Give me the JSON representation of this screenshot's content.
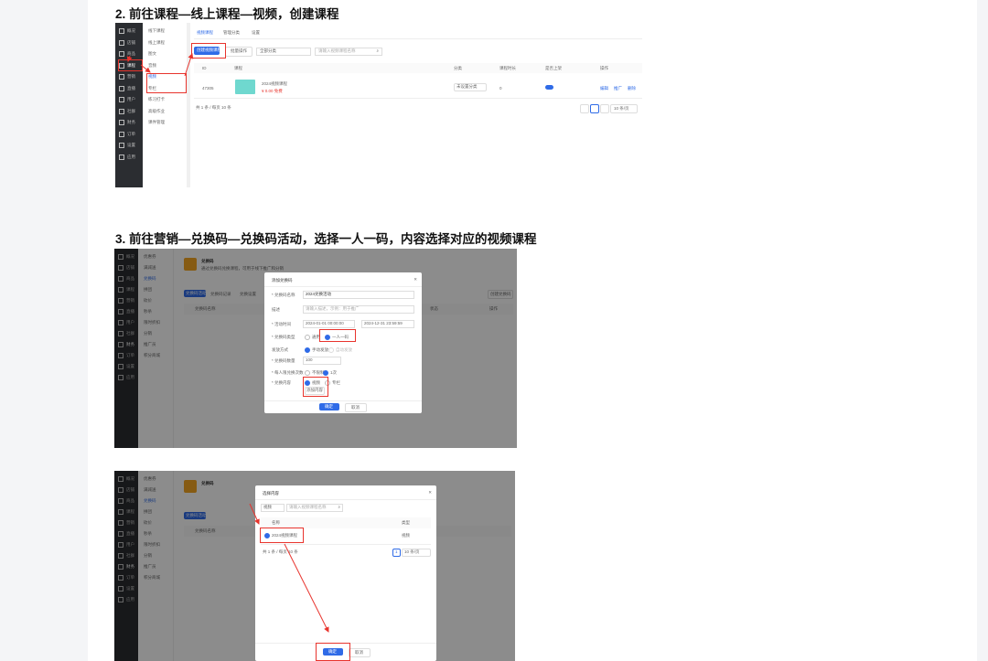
{
  "step2": {
    "heading": "2. 前往课程—线上课程—视频，创建课程",
    "sidebar": [
      "概况",
      "店铺",
      "商品",
      "课程",
      "营销",
      "直播",
      "用户",
      "社群",
      "财务",
      "订单",
      "设置",
      "应用"
    ],
    "submenu": [
      "线下课程",
      "线上课程",
      "图文",
      "音频",
      "视频",
      "专栏",
      "练习打卡",
      "高级作业",
      "课件管理"
    ],
    "tabs": [
      "视频课程",
      "管理分类",
      "设置"
    ],
    "create_button": "创建视频课程",
    "batch_button": "批量操作",
    "category_select": "全部分类",
    "search_placeholder": "请输入视频课程名称",
    "table_headers": [
      "ID",
      "课程",
      "分类",
      "课程时长",
      "是否上架",
      "操作"
    ],
    "row": {
      "id": "47305",
      "title": "2024视频课程",
      "price": "¥ 0.00 免费",
      "tag": "未设置分类",
      "count": "0",
      "actions": [
        "编辑",
        "推广",
        "删除"
      ]
    },
    "footer": "共 1 条 / 每页 10 条",
    "page_size": "10 条/页"
  },
  "step3": {
    "heading": "3. 前往营销—兑换码—兑换码活动，选择一人一码，内容选择对应的视频课程",
    "modal_title": "添加兑换码",
    "fields": [
      {
        "label": "* 兑换码名称",
        "value": "2024兑换活动"
      },
      {
        "label": "描述",
        "value": "请输入描述，示例：用于推广"
      },
      {
        "label": "* 活动时间",
        "value": "2024-01-01 00:00:00",
        "value2": "2024-12-31 23:59:59"
      },
      {
        "label": "* 兑换码类型",
        "option_a": "通用",
        "option_b": "一人一码"
      },
      {
        "label": "发放方式",
        "option_a": "手动发放",
        "option_b": "自动发放"
      },
      {
        "label": "* 兑换码数量",
        "value": "100"
      },
      {
        "label": "* 每人限兑换次数",
        "option_a": "不限制",
        "option_b": "1次"
      },
      {
        "label": "* 兑换内容",
        "option_a": "视频",
        "option_b": "专栏",
        "link": "添加内容"
      }
    ],
    "confirm": "确定",
    "cancel": "取消",
    "bg_tabs": [
      "兑换码活动",
      "兑换码记录",
      "兑换设置"
    ],
    "bg_title": "兑换码",
    "bg_subtitle": "通过兑换码兑换课程，可用于线下推广和分销",
    "bg_col": "兑换码名称",
    "bg_col2": "状态",
    "bg_col3": "操作",
    "bg_btn": "创建兑换码"
  },
  "step3b": {
    "modal_title": "选择内容",
    "filter": "视频",
    "search_placeholder": "请输入视频课程名称",
    "col_name": "名称",
    "col_type": "类型",
    "item": "2024视频课程",
    "item_type": "视频",
    "footer": "共 1 条 / 每页 10 条",
    "page": "1",
    "page_size": "10 条/页",
    "confirm": "确定",
    "cancel": "取消"
  },
  "colors": {
    "red": "#e8342d",
    "blue": "#2f6be7",
    "sidebar": "#2b2d31"
  }
}
